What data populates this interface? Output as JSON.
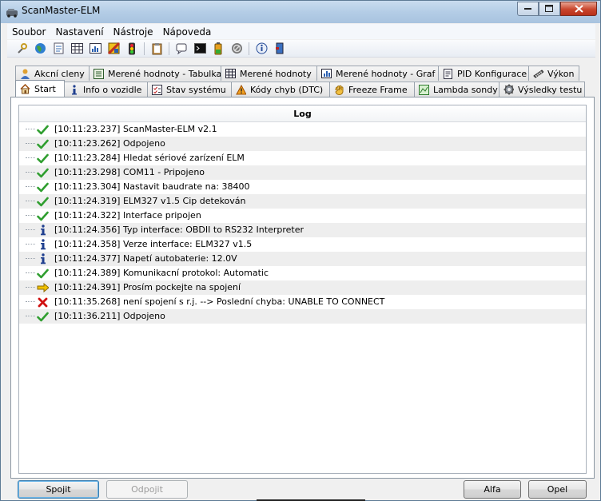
{
  "window": {
    "title": "ScanMaster-ELM"
  },
  "menu": [
    "Soubor",
    "Nastavení",
    "Nástroje",
    "Nápoveda"
  ],
  "toolbar_icons": [
    "wrench-icon",
    "globe-icon",
    "document-icon",
    "table-icon",
    "graph-icon",
    "flag-icon",
    "traffic-light-icon",
    "clipboard-icon",
    "chat-icon",
    "terminal-icon",
    "battery-icon",
    "disabled-icon",
    "info-icon",
    "exit-icon"
  ],
  "tabs_top": [
    {
      "label": "Akcní cleny",
      "icon": "person-icon"
    },
    {
      "label": "Merené hodnoty - Tabulka",
      "icon": "list-icon"
    },
    {
      "label": "Merené hodnoty",
      "icon": "grid-icon"
    },
    {
      "label": "Merené hodnoty - Graf",
      "icon": "chart-icon"
    },
    {
      "label": "PID Konfigurace",
      "icon": "page-icon"
    },
    {
      "label": "Výkon",
      "icon": "tire-icon"
    }
  ],
  "tabs_bottom": [
    {
      "label": "Start",
      "icon": "home-icon"
    },
    {
      "label": "Info o vozidle",
      "icon": "info-icon"
    },
    {
      "label": "Stav systému",
      "icon": "checklist-icon"
    },
    {
      "label": "Kódy chyb (DTC)",
      "icon": "warning-icon"
    },
    {
      "label": "Freeze Frame",
      "icon": "hand-icon"
    },
    {
      "label": "Lambda sondy",
      "icon": "sensor-icon"
    },
    {
      "label": "Výsledky testu",
      "icon": "gear-icon"
    }
  ],
  "log": {
    "header": "Log",
    "entries": [
      {
        "type": "ok",
        "text": "[10:11:23.237] ScanMaster-ELM v2.1"
      },
      {
        "type": "ok",
        "text": "[10:11:23.262] Odpojeno"
      },
      {
        "type": "ok",
        "text": "[10:11:23.284] Hledat sériové zarízení ELM"
      },
      {
        "type": "ok",
        "text": "[10:11:23.298] COM11 - Pripojeno"
      },
      {
        "type": "ok",
        "text": "[10:11:23.304] Nastavit baudrate na: 38400"
      },
      {
        "type": "ok",
        "text": "[10:11:24.319] ELM327 v1.5 Cip detekován"
      },
      {
        "type": "ok",
        "text": "[10:11:24.322] Interface pripojen"
      },
      {
        "type": "info",
        "text": "[10:11:24.356] Typ interface: OBDII to RS232 Interpreter"
      },
      {
        "type": "info",
        "text": "[10:11:24.358]  Verze interface: ELM327 v1.5"
      },
      {
        "type": "info",
        "text": "[10:11:24.377] Napetí autobaterie: 12.0V"
      },
      {
        "type": "ok",
        "text": "[10:11:24.389] Komunikacní protokol: Automatic"
      },
      {
        "type": "arrow",
        "text": "[10:11:24.391] Prosím pockejte na spojení"
      },
      {
        "type": "error",
        "text": "[10:11:35.268] není spojení s r.j. --> Poslední chyba: UNABLE TO CONNECT"
      },
      {
        "type": "ok",
        "text": "[10:11:36.211] Odpojeno"
      }
    ]
  },
  "buttons": {
    "connect": "Spojit",
    "disconnect": "Odpojit",
    "alfa": "Alfa",
    "quit": "Opel"
  },
  "colors": {
    "ok": "#2f9e2f",
    "info": "#1f3f8f",
    "arrow": "#f2c200",
    "error": "#d01010"
  }
}
